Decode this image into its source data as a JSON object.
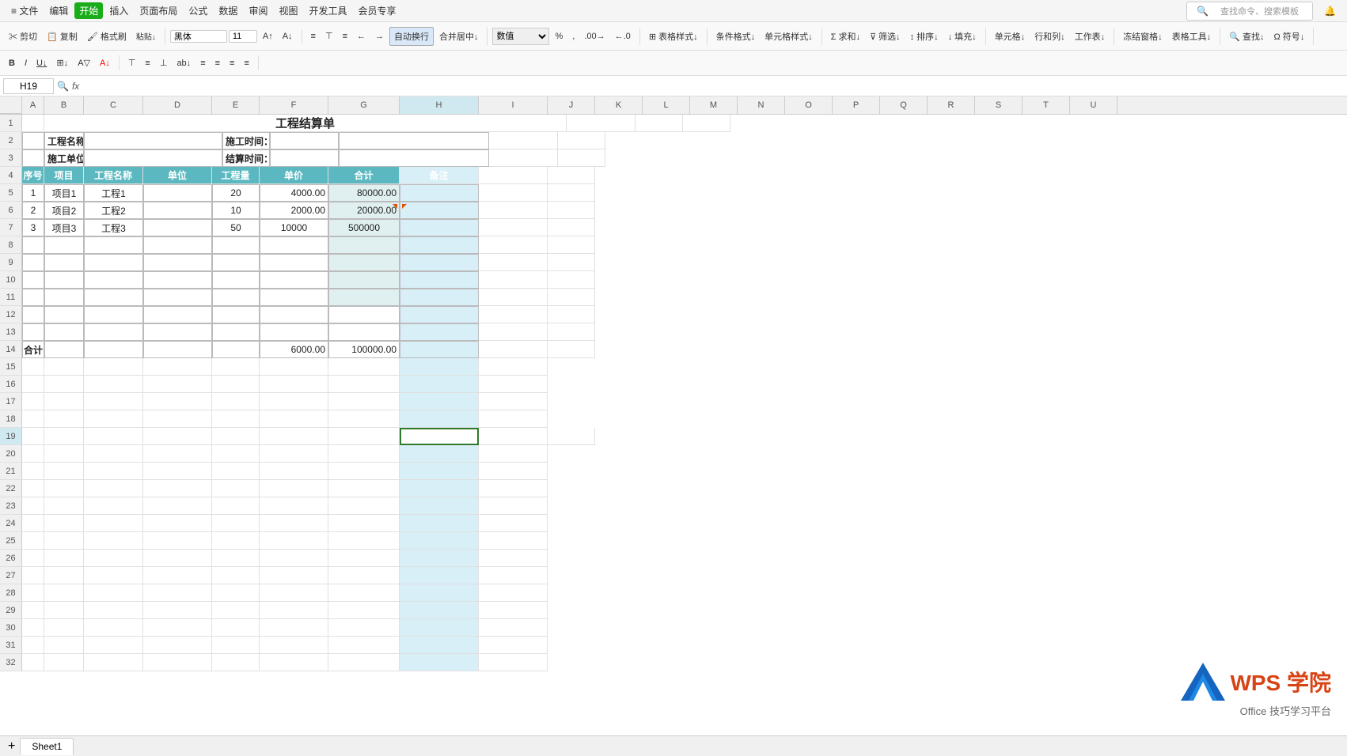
{
  "app": {
    "title": "工程结算单"
  },
  "menubar": {
    "items": [
      "≡ 文件",
      "编辑",
      "视图",
      "插入",
      "页面布局",
      "公式",
      "数据",
      "审阅",
      "视图",
      "开发工具",
      "会员专享"
    ],
    "start_btn": "开始",
    "search_placeholder": "查找命令、搜索模板"
  },
  "toolbar": {
    "font": "黑体",
    "font_size": "11",
    "format_type": "数值"
  },
  "formula_bar": {
    "cell_ref": "H19",
    "formula": ""
  },
  "columns": [
    "A",
    "B",
    "C",
    "D",
    "E",
    "F",
    "G",
    "H",
    "I",
    "J",
    "K",
    "L",
    "M",
    "N",
    "O",
    "P",
    "Q",
    "R",
    "S",
    "T",
    "U"
  ],
  "selected_col": "H",
  "selected_row": 19,
  "table": {
    "title": "工程结算单",
    "project_name_label": "工程名称：",
    "construction_unit_label": "施工单位：",
    "construction_time_label": "施工时间：",
    "settlement_time_label": "结算时间：",
    "headers": [
      "序号",
      "项目",
      "工程名称",
      "单位",
      "工程量",
      "单价",
      "合计",
      "备注"
    ],
    "rows": [
      {
        "seq": "1",
        "project": "项目1",
        "name": "工程1",
        "unit": "",
        "qty": "20",
        "price": "4000.00",
        "total": "80000.00",
        "remark": ""
      },
      {
        "seq": "2",
        "project": "项目2",
        "name": "工程2",
        "unit": "",
        "qty": "10",
        "price": "2000.00",
        "total": "20000.00",
        "remark": ""
      },
      {
        "seq": "3",
        "project": "项目3",
        "name": "工程3",
        "unit": "",
        "qty": "50",
        "price": "10000",
        "total": "500000",
        "remark": ""
      },
      {
        "seq": "",
        "project": "",
        "name": "",
        "unit": "",
        "qty": "",
        "price": "",
        "total": "",
        "remark": ""
      },
      {
        "seq": "",
        "project": "",
        "name": "",
        "unit": "",
        "qty": "",
        "price": "",
        "total": "",
        "remark": ""
      },
      {
        "seq": "",
        "project": "",
        "name": "",
        "unit": "",
        "qty": "",
        "price": "",
        "total": "",
        "remark": ""
      },
      {
        "seq": "",
        "project": "",
        "name": "",
        "unit": "",
        "qty": "",
        "price": "",
        "total": "",
        "remark": ""
      },
      {
        "seq": "",
        "project": "",
        "name": "",
        "unit": "",
        "qty": "",
        "price": "",
        "total": "",
        "remark": ""
      },
      {
        "seq": "",
        "project": "",
        "name": "",
        "unit": "",
        "qty": "",
        "price": "",
        "total": "",
        "remark": ""
      }
    ],
    "footer_label": "合计",
    "footer_price": "6000.00",
    "footer_total": "100000.00"
  },
  "sheet_tabs": [
    "Sheet1"
  ],
  "wps": {
    "logo_text": "WPS 学院",
    "subtitle": "Office 技巧学习平台"
  }
}
